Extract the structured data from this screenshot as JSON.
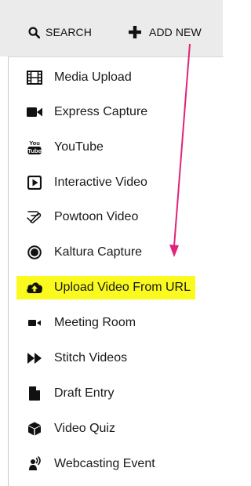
{
  "toolbar": {
    "search_label": "SEARCH",
    "add_new_label": "ADD NEW"
  },
  "menu": {
    "items": [
      {
        "label": "Media Upload",
        "icon": "film-icon"
      },
      {
        "label": "Express Capture",
        "icon": "video-camera-icon"
      },
      {
        "label": "YouTube",
        "icon": "youtube-icon"
      },
      {
        "label": "Interactive Video",
        "icon": "play-square-icon"
      },
      {
        "label": "Powtoon Video",
        "icon": "powtoon-icon"
      },
      {
        "label": "Kaltura Capture",
        "icon": "record-icon"
      },
      {
        "label": "Upload Video From URL",
        "icon": "cloud-upload-icon",
        "highlighted": true
      },
      {
        "label": "Meeting Room",
        "icon": "camera-small-icon"
      },
      {
        "label": "Stitch Videos",
        "icon": "fast-forward-icon"
      },
      {
        "label": "Draft Entry",
        "icon": "file-icon"
      },
      {
        "label": "Video Quiz",
        "icon": "cube-icon"
      },
      {
        "label": "Webcasting Event",
        "icon": "webcast-icon"
      }
    ]
  },
  "colors": {
    "toolbar_bg": "#ebebeb",
    "highlight": "#fafa1e",
    "annotation_arrow": "#e0247a"
  }
}
